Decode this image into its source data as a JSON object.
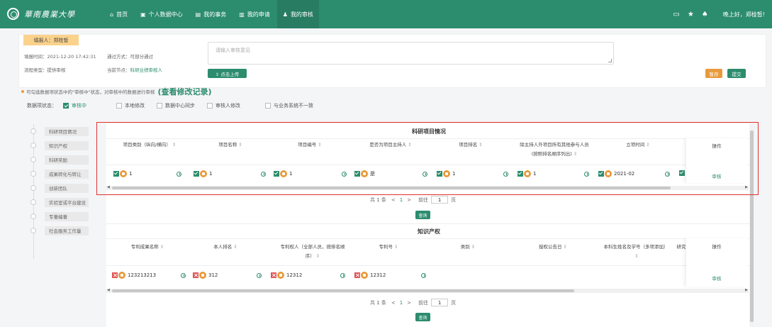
{
  "header": {
    "logo_text": "華南農業大學",
    "nav": [
      {
        "icon": "home-icon",
        "glyph": "⌂",
        "label": "首页"
      },
      {
        "icon": "personal-data-icon",
        "glyph": "▣",
        "label": "个人数据中心"
      },
      {
        "icon": "affairs-icon",
        "glyph": "▤",
        "label": "我的事务"
      },
      {
        "icon": "application-icon",
        "glyph": "▥",
        "label": "我的申请"
      },
      {
        "icon": "review-icon",
        "glyph": "♟",
        "label": "我的审核"
      }
    ],
    "right_icons": [
      {
        "name": "message-icon",
        "glyph": "▭"
      },
      {
        "name": "star-icon",
        "glyph": "★"
      },
      {
        "name": "bell-icon",
        "glyph": "♠"
      }
    ],
    "greeting": "晚上好，郑桂皙!"
  },
  "form": {
    "filler": "填报人：郑桂皙",
    "fill_time": "填报时间：2021-12-20 17:42:31",
    "pass_mode": "通过方式：可部分通过",
    "flow_type": "流程类型：提供审核",
    "current_node_label": "当前节点：",
    "current_node_value": "科研业绩审核人",
    "comment_placeholder": "请输入审核意见",
    "upload_label": "⇪ 点击上传",
    "save_label": "暂存",
    "submit_label": "提交"
  },
  "notice": {
    "text": "可勾选数据项状态中的\"审核中\"状态，对审核中的数据进行审核",
    "link": "(查看修改记录)"
  },
  "status": {
    "label": "数据项状态：",
    "items": [
      {
        "label": "审核中",
        "checked": true
      },
      {
        "label": "本地修改",
        "checked": false
      },
      {
        "label": "数据中心同步",
        "checked": false
      },
      {
        "label": "审核人修改",
        "checked": false
      },
      {
        "label": "与业务系统不一致",
        "checked": false
      }
    ]
  },
  "sidebar": {
    "items": [
      "科研项目情况",
      "知识产权",
      "科研奖励",
      "成果转化与转让",
      "创新团队",
      "实验室或平台建设",
      "专著编著",
      "社会服务工作量"
    ]
  },
  "research": {
    "title": "科研项目情况",
    "headers": [
      "项目类别（纵向/横向）",
      "项目名称",
      "项目编号",
      "是否为项目主持人",
      "项目排名",
      "除主持人外项目所有其他参与人员",
      "(按照排名顺序列出)",
      "立项时间"
    ],
    "values": [
      "1",
      "1",
      "1",
      "是",
      "1",
      "1",
      "2021-02"
    ],
    "op_header": "操作",
    "op_link": "审核"
  },
  "ip": {
    "title": "知识产权",
    "headers": [
      "专利成果名称",
      "本人排名",
      "专利权人（全部人员，按排名顺",
      "序）",
      "专利号",
      "类别",
      "授权公告日",
      "本科生姓名及学号（多项添加）",
      "研究"
    ],
    "values": [
      "123213213",
      "312",
      "12312",
      "12312"
    ],
    "op_header": "操作",
    "op_link": "审核"
  },
  "pagination": {
    "total": "共 1 条",
    "prev": "<",
    "current": "1",
    "next": ">",
    "goto": "前往",
    "page_value": "1",
    "page_unit": "页",
    "query_label": "查询"
  },
  "sort_glyph": "⇕",
  "colors": {
    "brand": "#2c8c6e",
    "accent": "#e89a3c",
    "highlight": "#e0302d"
  }
}
